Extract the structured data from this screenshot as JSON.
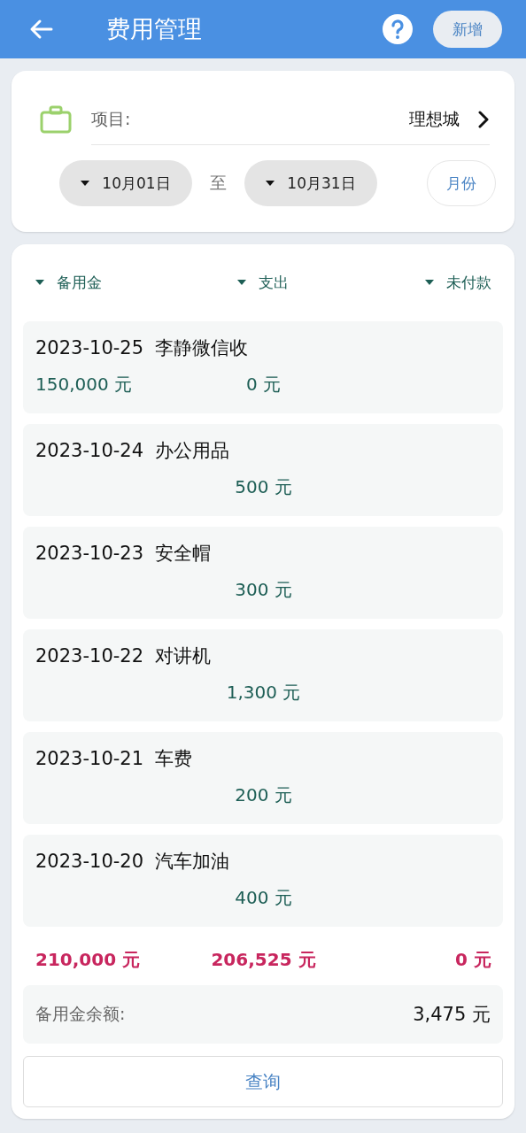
{
  "header": {
    "title": "费用管理",
    "add_button": "新增"
  },
  "filter": {
    "project_label": "项目:",
    "project_value": "理想城",
    "start_date": "10月01日",
    "separator": "至",
    "end_date": "10月31日",
    "month_button": "月份"
  },
  "columns": [
    "备用金",
    "支出",
    "未付款"
  ],
  "records": [
    {
      "date": "2023-10-25",
      "title": "李静微信收",
      "reserve": "150,000 元",
      "expense": "0 元"
    },
    {
      "date": "2023-10-24",
      "title": "办公用品",
      "expense": "500 元"
    },
    {
      "date": "2023-10-23",
      "title": "安全帽",
      "expense": "300 元"
    },
    {
      "date": "2023-10-22",
      "title": "对讲机",
      "expense": "1,300 元"
    },
    {
      "date": "2023-10-21",
      "title": "车费",
      "expense": "200 元"
    },
    {
      "date": "2023-10-20",
      "title": "汽车加油",
      "expense": "400 元"
    }
  ],
  "totals": [
    "210,000 元",
    "206,525 元",
    "0 元"
  ],
  "balance": {
    "label": "备用金余额:",
    "value": "3,475 元"
  },
  "query_button": "查询"
}
